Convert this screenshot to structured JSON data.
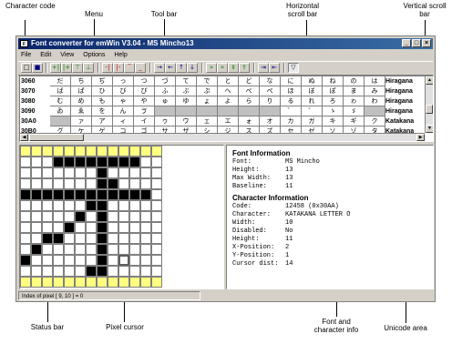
{
  "annotations": {
    "character_code": "Character code",
    "menu": "Menu",
    "tool_bar": "Tool bar",
    "horizontal_scroll_bar": "Horizontal scroll bar",
    "vertical_scroll_bar": "Vertical scroll bar",
    "status_bar": "Status bar",
    "pixel_cursor": "Pixel cursor",
    "font_and_character_info": "Font and character info",
    "unicode_area": "Unicode area"
  },
  "window": {
    "title": "Font converter for emWin V3.04 - MS Mincho13",
    "icon_text": "F",
    "minimize": "_",
    "maximize": "□",
    "close": "×"
  },
  "menu": [
    "File",
    "Edit",
    "View",
    "Options",
    "Help"
  ],
  "charset": {
    "rows": [
      {
        "code": "3060",
        "chars": [
          "だ",
          "ち",
          "ぢ",
          "っ",
          "つ",
          "づ",
          "て",
          "で",
          "と",
          "ど",
          "な",
          "に",
          "ぬ",
          "ね",
          "の",
          "は"
        ],
        "unicode": "Hiragana"
      },
      {
        "code": "3070",
        "chars": [
          "ば",
          "ぱ",
          "ひ",
          "び",
          "ぴ",
          "ふ",
          "ぶ",
          "ぷ",
          "へ",
          "べ",
          "ぺ",
          "ほ",
          "ぼ",
          "ぽ",
          "ま",
          "み"
        ],
        "unicode": "Hiragana"
      },
      {
        "code": "3080",
        "chars": [
          "む",
          "め",
          "も",
          "ゃ",
          "や",
          "ゅ",
          "ゆ",
          "ょ",
          "よ",
          "ら",
          "り",
          "る",
          "れ",
          "ろ",
          "ゎ",
          "わ"
        ],
        "unicode": "Hiragana"
      },
      {
        "code": "3090",
        "chars": [
          "ゐ",
          "ゑ",
          "を",
          "ん",
          "ゔ",
          "",
          "",
          "",
          "",
          "",
          "",
          "゛",
          "゜",
          "ゝ",
          "ゞ",
          ""
        ],
        "unicode": "Hiragana"
      },
      {
        "code": "30A0",
        "chars": [
          "",
          "ァ",
          "ア",
          "ィ",
          "イ",
          "ゥ",
          "ウ",
          "ェ",
          "エ",
          "ォ",
          "オ",
          "カ",
          "ガ",
          "キ",
          "ギ",
          "ク"
        ],
        "unicode": "Katakana"
      },
      {
        "code": "30B0",
        "chars": [
          "グ",
          "ケ",
          "ゲ",
          "コ",
          "ゴ",
          "サ",
          "ザ",
          "シ",
          "ジ",
          "ス",
          "ズ",
          "セ",
          "ゼ",
          "ソ",
          "ゾ",
          "タ"
        ],
        "unicode": "Katakana"
      }
    ]
  },
  "font_info": {
    "heading": "Font Information",
    "fields": [
      {
        "key": "Font:",
        "value": "MS Mincho"
      },
      {
        "key": "Height:",
        "value": "13"
      },
      {
        "key": "Max Width:",
        "value": "13"
      },
      {
        "key": "Baseline:",
        "value": "11"
      }
    ]
  },
  "char_info": {
    "heading": "Character Information",
    "fields": [
      {
        "key": "Code:",
        "value": "12458 (0x30AA)"
      },
      {
        "key": "Character:",
        "value": "KATAKANA LETTER O"
      },
      {
        "key": "Width:",
        "value": "10"
      },
      {
        "key": "Disabled:",
        "value": "No"
      },
      {
        "key": "Height:",
        "value": "11"
      },
      {
        "key": "X-Position:",
        "value": "2"
      },
      {
        "key": "Y-Position:",
        "value": "1"
      },
      {
        "key": "Cursor dist:",
        "value": "14"
      }
    ]
  },
  "status": "Index of pixel [ 9, 10 ] = 0",
  "colors": {
    "title_bar": "#0a246a",
    "window_face": "#d4d0c8",
    "disabled_cell": "#c0c0c0",
    "pixel_on": "#000000",
    "pixel_off": "#ffffff",
    "pixel_margin": "#ffff80"
  },
  "icons": {
    "toolbar": [
      "new-file-icon",
      "save-icon",
      "shift-left-icon",
      "shift-right-icon",
      "shift-up-icon",
      "shift-down-icon",
      "align-left-icon",
      "align-right-icon",
      "align-top-icon",
      "align-bottom-icon",
      "move-right-icon",
      "move-left-icon",
      "move-up-icon",
      "move-down-icon",
      "grow-horizontal-icon",
      "shrink-horizontal-icon",
      "grow-vertical-icon",
      "shrink-vertical-icon",
      "narrow-icon",
      "widen-icon",
      "filter-icon"
    ]
  }
}
